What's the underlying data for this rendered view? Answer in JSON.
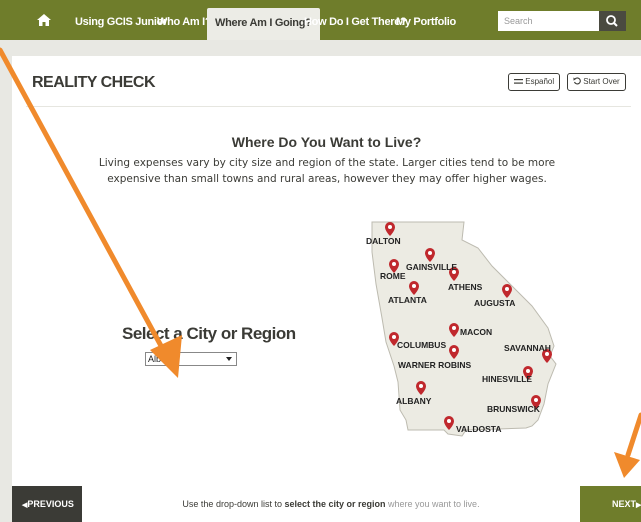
{
  "nav": {
    "home_icon": "home-icon",
    "items": [
      {
        "label": "Using GCIS Junior"
      },
      {
        "label": "Who Am I?"
      },
      {
        "label": "Where Am I Going?",
        "active": true
      },
      {
        "label": "How Do I Get There?"
      },
      {
        "label": "My Portfolio"
      }
    ],
    "search_placeholder": "Search",
    "search_icon": "search-icon"
  },
  "page": {
    "title": "REALITY CHECK",
    "espanol_label": "Español",
    "start_over_label": "Start Over",
    "headline": "Where Do You Want to Live?",
    "description": "Living expenses vary by city size and region of the state. Larger cities tend to be more expensive than small towns and rural areas, however they may offer higher wages."
  },
  "selector": {
    "label": "Select a City or Region",
    "value": "Albany"
  },
  "map": {
    "cities": [
      "DALTON",
      "GAINSVILLE",
      "ROME",
      "ATHENS",
      "ATLANTA",
      "AUGUSTA",
      "MACON",
      "COLUMBUS",
      "SAVANNAH",
      "WARNER ROBINS",
      "HINESVILLE",
      "ALBANY",
      "BRUNSWICK",
      "VALDOSTA"
    ],
    "pin_color": "#c0282d",
    "state_fill": "#ecebe3"
  },
  "footer": {
    "prev_label": "PREVIOUS",
    "next_label": "NEXT",
    "instruction": {
      "p1": "Use the drop-down list to ",
      "p2": "select the city or region",
      "p3": " where you want to live."
    }
  },
  "colors": {
    "nav_bg": "#6f7d2b",
    "annotation_arrow": "#f08a2c"
  }
}
